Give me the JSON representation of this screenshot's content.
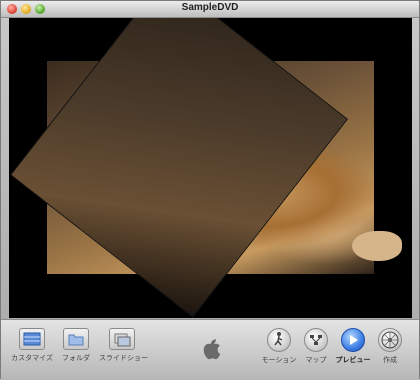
{
  "window": {
    "title": "SampleDVD"
  },
  "toolbar": {
    "left": [
      {
        "label": "カスタマイズ",
        "icon": "customize-icon"
      },
      {
        "label": "フォルダ",
        "icon": "folder-icon"
      },
      {
        "label": "スライドショー",
        "icon": "slideshow-icon"
      }
    ],
    "right": [
      {
        "label": "モーション",
        "icon": "motion-icon"
      },
      {
        "label": "マップ",
        "icon": "map-icon"
      },
      {
        "label": "プレビュー",
        "icon": "preview-play-icon",
        "active": true
      },
      {
        "label": "作成",
        "icon": "burn-icon"
      }
    ]
  },
  "colors": {
    "accent": "#3d7fe6"
  }
}
